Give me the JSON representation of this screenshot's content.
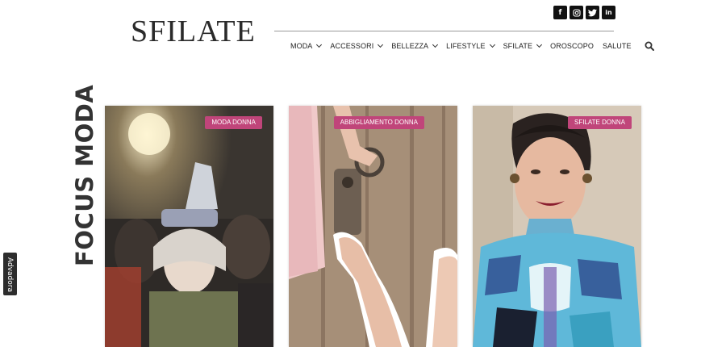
{
  "header": {
    "logo": "SFILATE",
    "social": [
      {
        "icon": "facebook-icon",
        "glyph": "f"
      },
      {
        "icon": "instagram-icon",
        "glyph": ""
      },
      {
        "icon": "twitter-icon",
        "glyph": ""
      },
      {
        "icon": "linkedin-icon",
        "glyph": "in"
      }
    ]
  },
  "nav": {
    "items": [
      {
        "label": "MODA",
        "dropdown": true
      },
      {
        "label": "ACCESSORI",
        "dropdown": true
      },
      {
        "label": "BELLEZZA",
        "dropdown": true
      },
      {
        "label": "LIFESTYLE",
        "dropdown": true
      },
      {
        "label": "SFILATE",
        "dropdown": true
      },
      {
        "label": "OROSCOPO",
        "dropdown": false
      },
      {
        "label": "SALUTE",
        "dropdown": false
      }
    ],
    "search_icon": "search-icon"
  },
  "section": {
    "title": "FOCUS MODA"
  },
  "side_tab": {
    "label": "Advadora"
  },
  "cards": [
    {
      "badge": "MODA DONNA"
    },
    {
      "badge": "ABBIGLIAMENTO DONNA"
    },
    {
      "badge": "SFILATE DONNA"
    }
  ],
  "colors": {
    "badge": "#c0457a",
    "social_bg": "#111111",
    "title": "#333333"
  }
}
